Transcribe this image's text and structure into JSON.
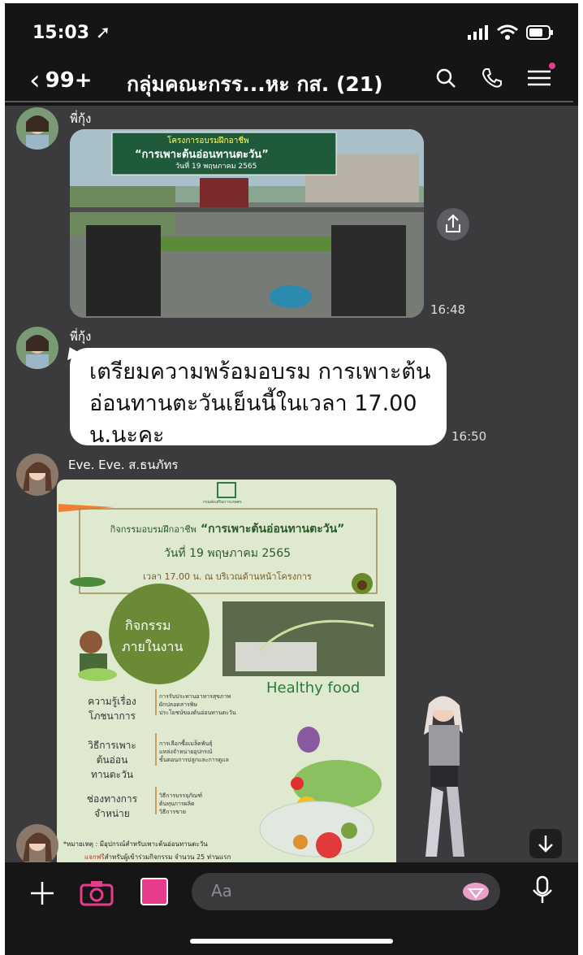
{
  "status_bar": {
    "time": "15:03"
  },
  "header": {
    "back_count": "99+",
    "title": "กลุ่มคณะกรร...หะ กส. (21)"
  },
  "messages": [
    {
      "sender": "พี่กุ้ง",
      "type": "photo",
      "time": "16:48"
    },
    {
      "sender": "พี่กุ้ง",
      "type": "text",
      "text": "เตรียมความพร้อมอบรม การเพาะต้นอ่อนทานตะวันเย็นนี้ในเวลา 17.00 น.นะคะ",
      "time": "16:50"
    },
    {
      "sender": "Eve. Eve. ส.ธนภัทร",
      "type": "poster"
    }
  ],
  "poster": {
    "logo_caption": "กรมส่งเสริมการเกษตร",
    "activity_prefix": "กิจกรรมอบรมฝึกอาชีพ",
    "activity_title": "“การเพาะต้นอ่อนทานตะวัน”",
    "date": "วันที่ 19 พฤษภาคม 2565",
    "time_place": "เวลา 17.00 น. ณ บริเวณด้านหน้าโครงการ",
    "circle_text_1": "กิจกรรม",
    "circle_text_2": "ภายในงาน",
    "healthy": "Healthy food",
    "topics": [
      {
        "title_1": "ความรู้เรื่อง",
        "title_2": "โภชนาการ",
        "details": [
          "การรับประทานอาหารสุขภาพ",
          "ผักปลอดสารพิษ",
          "ประโยชน์ของต้นอ่อนทานตะวัน"
        ]
      },
      {
        "title_1": "วิธีการเพาะ",
        "title_2": "ต้นอ่อน",
        "title_3": "ทานตะวัน",
        "details": [
          "การเลือกซื้อเมล็ดพันธุ์",
          "แหล่งจำหน่ายอุปกรณ์",
          "ขั้นตอนการปลูกและการดูแล"
        ]
      },
      {
        "title_1": "ช่องทางการ",
        "title_2": "จำหน่าย",
        "details": [
          "วิธีการบรรจุภัณฑ์",
          "ต้นทุนการผลิต",
          "วิธีการขาย"
        ]
      }
    ],
    "note": "*หมายเหตุ : มีอุปกรณ์สำหรับเพาะต้นอ่อนทานตะวัน",
    "note2_red": "แจกฟรี",
    "note2_rest": "สำหรับผู้เข้าร่วมกิจกรรม จำนวน 25 ท่านแรก"
  },
  "photo_banner": {
    "line1": "โครงการอบรมฝึกอาชีพ",
    "line2": "“การเพาะต้นอ่อนทานตะวัน”",
    "line3": "วันที่ 19 พฤษภาคม 2565"
  },
  "composer": {
    "placeholder": "Aa"
  },
  "colors": {
    "accent_pink": "#e73c8c",
    "bubble": "#ffffff",
    "poster_bg": "#dfe9cf",
    "poster_green": "#6a8a35"
  }
}
